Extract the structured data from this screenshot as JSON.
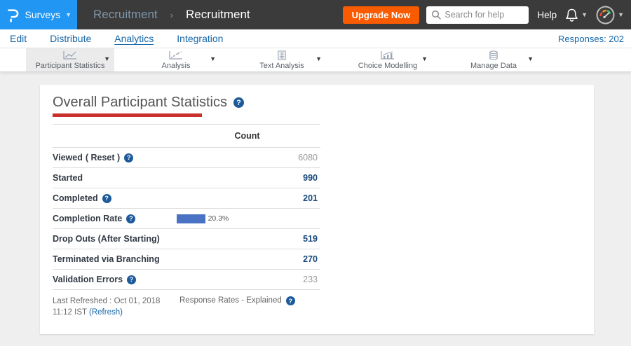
{
  "header": {
    "product_menu": "Surveys",
    "breadcrumb_parent": "Recruitment",
    "breadcrumb_separator": "›",
    "breadcrumb_current": "Recruitment",
    "upgrade_button": "Upgrade Now",
    "search_placeholder": "Search for help",
    "help_label": "Help"
  },
  "nav": {
    "items": [
      {
        "label": "Edit",
        "active": false
      },
      {
        "label": "Distribute",
        "active": false
      },
      {
        "label": "Analytics",
        "active": true
      },
      {
        "label": "Integration",
        "active": false
      }
    ],
    "responses_label": "Responses: 202"
  },
  "toolbar": {
    "tabs": [
      {
        "label": "Participant Statistics",
        "icon": "line-chart-icon",
        "selected": true
      },
      {
        "label": "Analysis",
        "icon": "trend-chart-icon",
        "selected": false
      },
      {
        "label": "Text Analysis",
        "icon": "document-grid-icon",
        "selected": false
      },
      {
        "label": "Choice Modelling",
        "icon": "mixed-chart-icon",
        "selected": false
      },
      {
        "label": "Manage Data",
        "icon": "database-icon",
        "selected": false
      }
    ]
  },
  "main": {
    "title": "Overall Participant Statistics",
    "table": {
      "count_header": "Count",
      "rows": [
        {
          "label": "Viewed",
          "reset": "( Reset )",
          "help": true,
          "value": "6080",
          "muted": true
        },
        {
          "label": "Started",
          "help": false,
          "value": "990",
          "muted": false
        },
        {
          "label": "Completed",
          "help": true,
          "value": "201",
          "muted": false
        },
        {
          "label": "Completion Rate",
          "help": true,
          "bar_percent": 20.3,
          "bar_label": "20.3%"
        },
        {
          "label": "Drop Outs (After Starting)",
          "help": false,
          "value": "519",
          "muted": false
        },
        {
          "label": "Terminated via Branching",
          "help": false,
          "value": "270",
          "muted": false
        },
        {
          "label": "Validation Errors",
          "help": true,
          "value": "233",
          "muted": true
        }
      ]
    },
    "footer": {
      "last_refreshed": "Last Refreshed : Oct 01, 2018 11:12 IST",
      "refresh_link": "(Refresh)",
      "response_rates_link": "Response Rates - Explained"
    }
  },
  "colors": {
    "accent_blue": "#2196f3",
    "upgrade_orange": "#f85b00",
    "link_blue": "#1767a8",
    "bar_blue": "#4a72c4",
    "underline_red": "#c9302c",
    "value_navy": "#1a4a7d"
  }
}
